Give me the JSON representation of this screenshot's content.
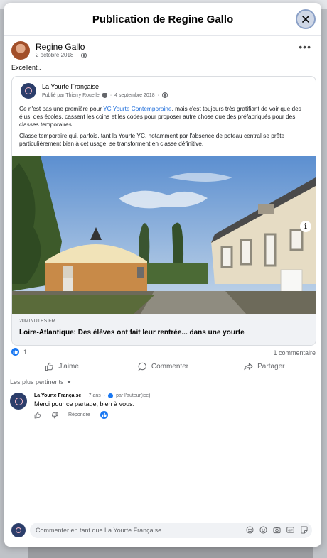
{
  "modal": {
    "title": "Publication de Regine Gallo"
  },
  "post": {
    "author": "Regine Gallo",
    "date": "2 octobre 2018",
    "text": "Excellent.."
  },
  "shared": {
    "page_name": "La Yourte Française",
    "published_by": "Publié par Thierry Rouelle",
    "date": "4 septembre 2018",
    "paragraph1_before": "Ce n'est pas une première pour ",
    "paragraph1_link": "YC Yourte Contemporaine",
    "paragraph1_after": ", mais c'est toujours très gratifiant de voir que des élus, des écoles, cassent les coins et les codes pour proposer autre chose que des préfabriqués pour des classes temporaires.",
    "paragraph2": "Classe temporaire qui, parfois, tant la Yourte YC, notamment par l'absence de poteau central se prête particulièrement bien à cet usage, se transforment en classe définitive.",
    "link_source": "20MINUTES.FR",
    "link_title": "Loire-Atlantique: Des élèves ont fait leur rentrée... dans une yourte"
  },
  "stats": {
    "likes": "1",
    "comments": "1 commentaire"
  },
  "actions": {
    "like": "J'aime",
    "comment": "Commenter",
    "share": "Partager"
  },
  "comments_filter": "Les plus pertinents",
  "comment": {
    "author": "La Yourte Française",
    "time": "7 ans",
    "author_badge": "par l'auteur(ice)",
    "text": "Merci pour ce partage, bien à vous.",
    "reply": "Répondre"
  },
  "composer": {
    "placeholder": "Commenter en tant que La Yourte Française"
  },
  "colors": {
    "accent": "#1877f2",
    "link": "#216fdb",
    "page_logo": "#2c3e6b"
  },
  "icons": [
    "close-icon",
    "globe-icon",
    "more-icon",
    "info-icon",
    "like-icon",
    "comment-icon",
    "share-icon",
    "thumbs-down-icon",
    "avatar-icon",
    "emoji-icon",
    "camera-icon",
    "gif-icon",
    "sticker-icon"
  ]
}
